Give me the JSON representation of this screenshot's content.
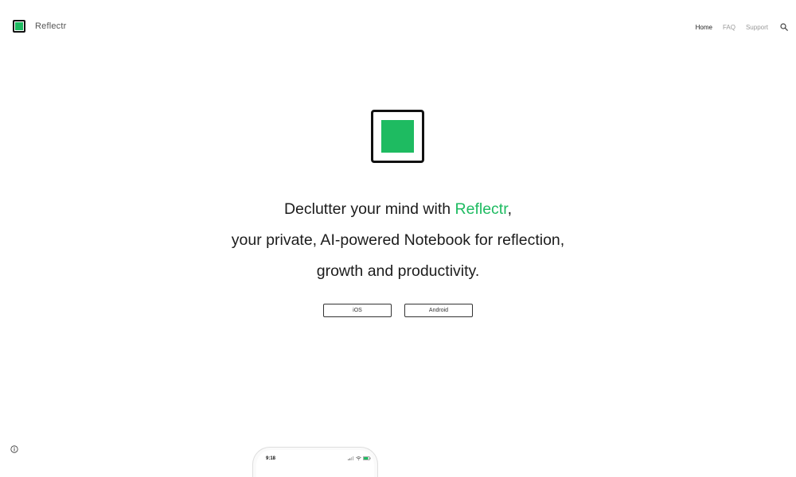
{
  "header": {
    "brand_name": "Reflectr",
    "nav": {
      "home": "Home",
      "faq": "FAQ",
      "support": "Support"
    }
  },
  "hero": {
    "line1_before": "Declutter your mind with ",
    "line1_accent": "Reflectr",
    "line1_after": ",",
    "line2": "your private, AI-powered Notebook for reflection,",
    "line3": "growth and productivity.",
    "buttons": {
      "ios": "iOS",
      "android": "Android"
    }
  },
  "phone": {
    "time": "9:18"
  },
  "colors": {
    "accent": "#1ebb61",
    "logo_border": "#111111",
    "nav_active": "#222222",
    "nav_inactive": "#9a9a9a"
  },
  "icons": {
    "brand": "reflectr-logo-icon",
    "search": "search-icon",
    "info": "info-icon"
  }
}
